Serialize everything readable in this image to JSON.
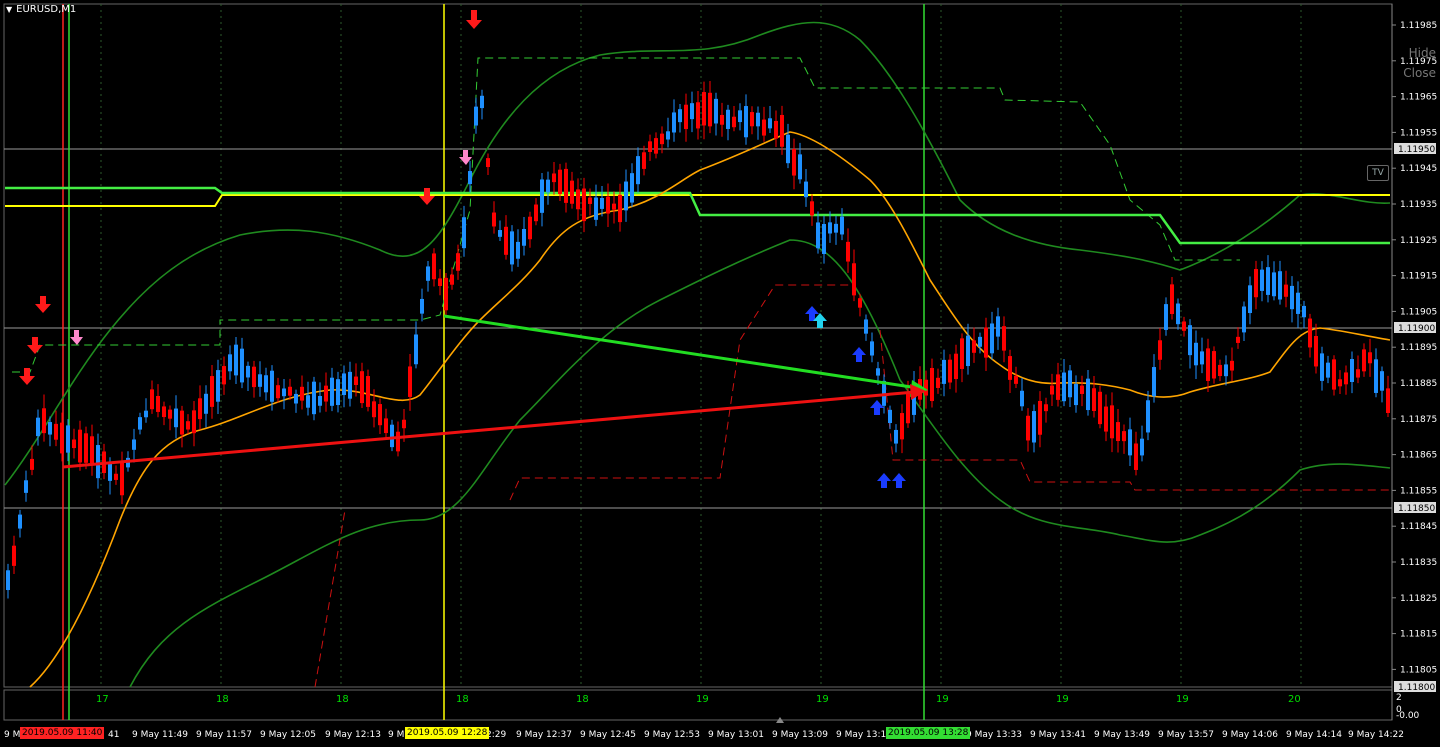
{
  "window": {
    "title": "EURUSD,M1"
  },
  "buttons": {
    "hide": "Hide",
    "close": "Close",
    "tv": "TV"
  },
  "price_axis": {
    "ticks": [
      "1.11985",
      "1.11975",
      "1.11965",
      "1.11955",
      "1.11945",
      "1.11935",
      "1.11925",
      "1.11915",
      "1.11905",
      "1.11895",
      "1.11885",
      "1.11875",
      "1.11865",
      "1.11855",
      "1.11845",
      "1.11835",
      "1.11825",
      "1.11815",
      "1.11805"
    ],
    "highlighted": [
      "1.11950",
      "1.11900",
      "1.11850",
      "1.11800"
    ]
  },
  "time_axis": {
    "labels": [
      "9 M",
      "5.09 11:40",
      "41",
      "9 May 11:49",
      "9 May 11:57",
      "9 May 12:05",
      "9 May 12:13",
      "9 M",
      "2019.05.09 12:28",
      "2:29",
      "9 May 12:37",
      "9 May 12:45",
      "9 May 12:53",
      "9 May 13:01",
      "9 May 13:09",
      "9 May 13:1",
      "2019.05.09 13:28",
      "9 May 13:33",
      "9 May 13:41",
      "9 May 13:49",
      "9 May 13:57",
      "9 May 14:06",
      "9 May 14:14",
      "9 May 14:22"
    ],
    "tag_red": "2019.05.09 11:40",
    "tag_yellow": "2019.05.09 12:28",
    "tag_green": "2019.05.09 13:28"
  },
  "subwindow": {
    "values": [
      "17",
      "18",
      "18",
      "18",
      "18",
      "19",
      "19",
      "19",
      "19",
      "19",
      "20",
      "20"
    ],
    "scale_top": "2",
    "scale_mid": "0",
    "scale_bottom": "-0.00"
  },
  "colors": {
    "background": "#000000",
    "bull_candle": "#1e90ff",
    "bear_candle": "#ff0000",
    "ma": "#ffa500",
    "bands": "#1f8a1f",
    "level_yellow": "#ffff00",
    "level_green": "#32cd32",
    "arrow_green": "#22dd22",
    "arrow_red": "#ee1111"
  }
}
